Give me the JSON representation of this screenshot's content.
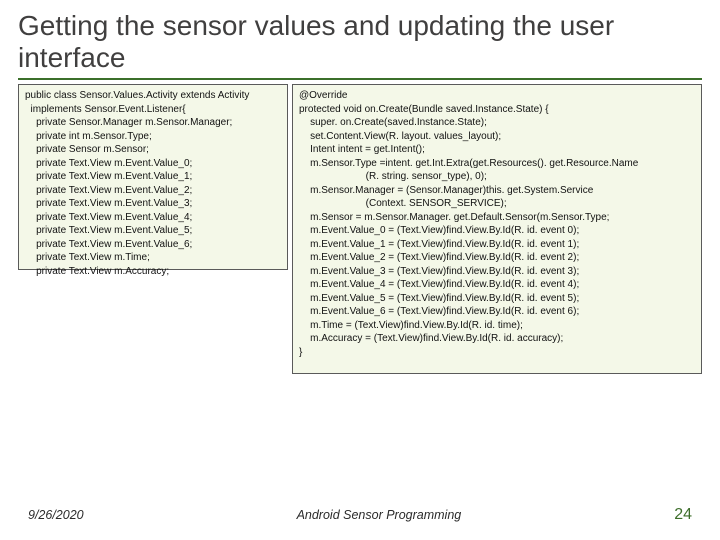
{
  "title": "Getting the sensor values and updating the user interface",
  "code_left": "public class Sensor.Values.Activity extends Activity\n  implements Sensor.Event.Listener{\n    private Sensor.Manager m.Sensor.Manager;\n    private int m.Sensor.Type;\n    private Sensor m.Sensor;\n    private Text.View m.Event.Value_0;\n    private Text.View m.Event.Value_1;\n    private Text.View m.Event.Value_2;\n    private Text.View m.Event.Value_3;\n    private Text.View m.Event.Value_4;\n    private Text.View m.Event.Value_5;\n    private Text.View m.Event.Value_6;\n    private Text.View m.Time;\n    private Text.View m.Accuracy;",
  "code_right": "@Override\nprotected void on.Create(Bundle saved.Instance.State) {\n    super. on.Create(saved.Instance.State);\n    set.Content.View(R. layout. values_layout);\n    Intent intent = get.Intent();\n    m.Sensor.Type =intent. get.Int.Extra(get.Resources(). get.Resource.Name\n                        (R. string. sensor_type), 0);\n    m.Sensor.Manager = (Sensor.Manager)this. get.System.Service\n                        (Context. SENSOR_SERVICE);\n    m.Sensor = m.Sensor.Manager. get.Default.Sensor(m.Sensor.Type;\n    m.Event.Value_0 = (Text.View)find.View.By.Id(R. id. event 0);\n    m.Event.Value_1 = (Text.View)find.View.By.Id(R. id. event 1);\n    m.Event.Value_2 = (Text.View)find.View.By.Id(R. id. event 2);\n    m.Event.Value_3 = (Text.View)find.View.By.Id(R. id. event 3);\n    m.Event.Value_4 = (Text.View)find.View.By.Id(R. id. event 4);\n    m.Event.Value_5 = (Text.View)find.View.By.Id(R. id. event 5);\n    m.Event.Value_6 = (Text.View)find.View.By.Id(R. id. event 6);\n    m.Time = (Text.View)find.View.By.Id(R. id. time);\n    m.Accuracy = (Text.View)find.View.By.Id(R. id. accuracy);\n}",
  "footer": {
    "date": "9/26/2020",
    "center": "Android Sensor Programming",
    "pageno": "24"
  }
}
